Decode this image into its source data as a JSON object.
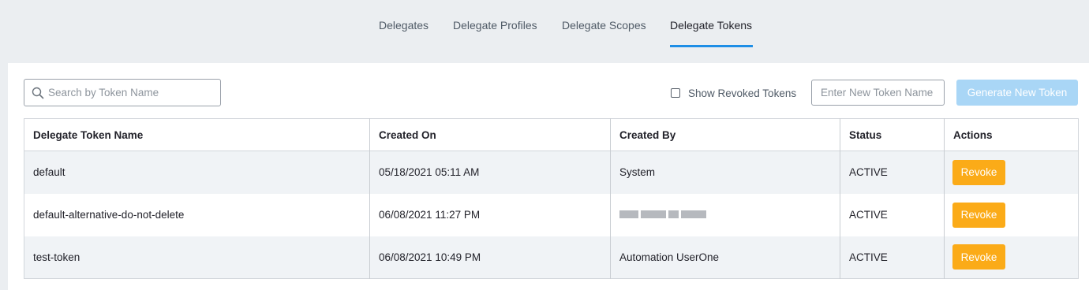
{
  "tabs": [
    {
      "label": "Delegates",
      "active": false
    },
    {
      "label": "Delegate Profiles",
      "active": false
    },
    {
      "label": "Delegate Scopes",
      "active": false
    },
    {
      "label": "Delegate Tokens",
      "active": true
    }
  ],
  "toolbar": {
    "search_placeholder": "Search by Token Name",
    "search_value": "",
    "show_revoked_label": "Show Revoked Tokens",
    "show_revoked_checked": false,
    "new_token_placeholder": "Enter New Token Name",
    "new_token_value": "",
    "generate_label": "Generate New Token"
  },
  "table": {
    "columns": [
      "Delegate Token Name",
      "Created On",
      "Created By",
      "Status",
      "Actions"
    ],
    "rows": [
      {
        "name": "default",
        "created_on": "05/18/2021 05:11 AM",
        "created_by": "System",
        "status": "ACTIVE",
        "action": "Revoke"
      },
      {
        "name": "default-alternative-do-not-delete",
        "created_on": "06/08/2021 11:27 PM",
        "created_by": "",
        "status": "ACTIVE",
        "action": "Revoke"
      },
      {
        "name": "test-token",
        "created_on": "06/08/2021 10:49 PM",
        "created_by": "Automation UserOne",
        "status": "ACTIVE",
        "action": "Revoke"
      }
    ]
  },
  "colors": {
    "accent": "#1e8ee6",
    "revoke_button": "#fbab18",
    "generate_button_disabled": "#a9d6f6"
  },
  "icons": {
    "search": "search-icon"
  }
}
